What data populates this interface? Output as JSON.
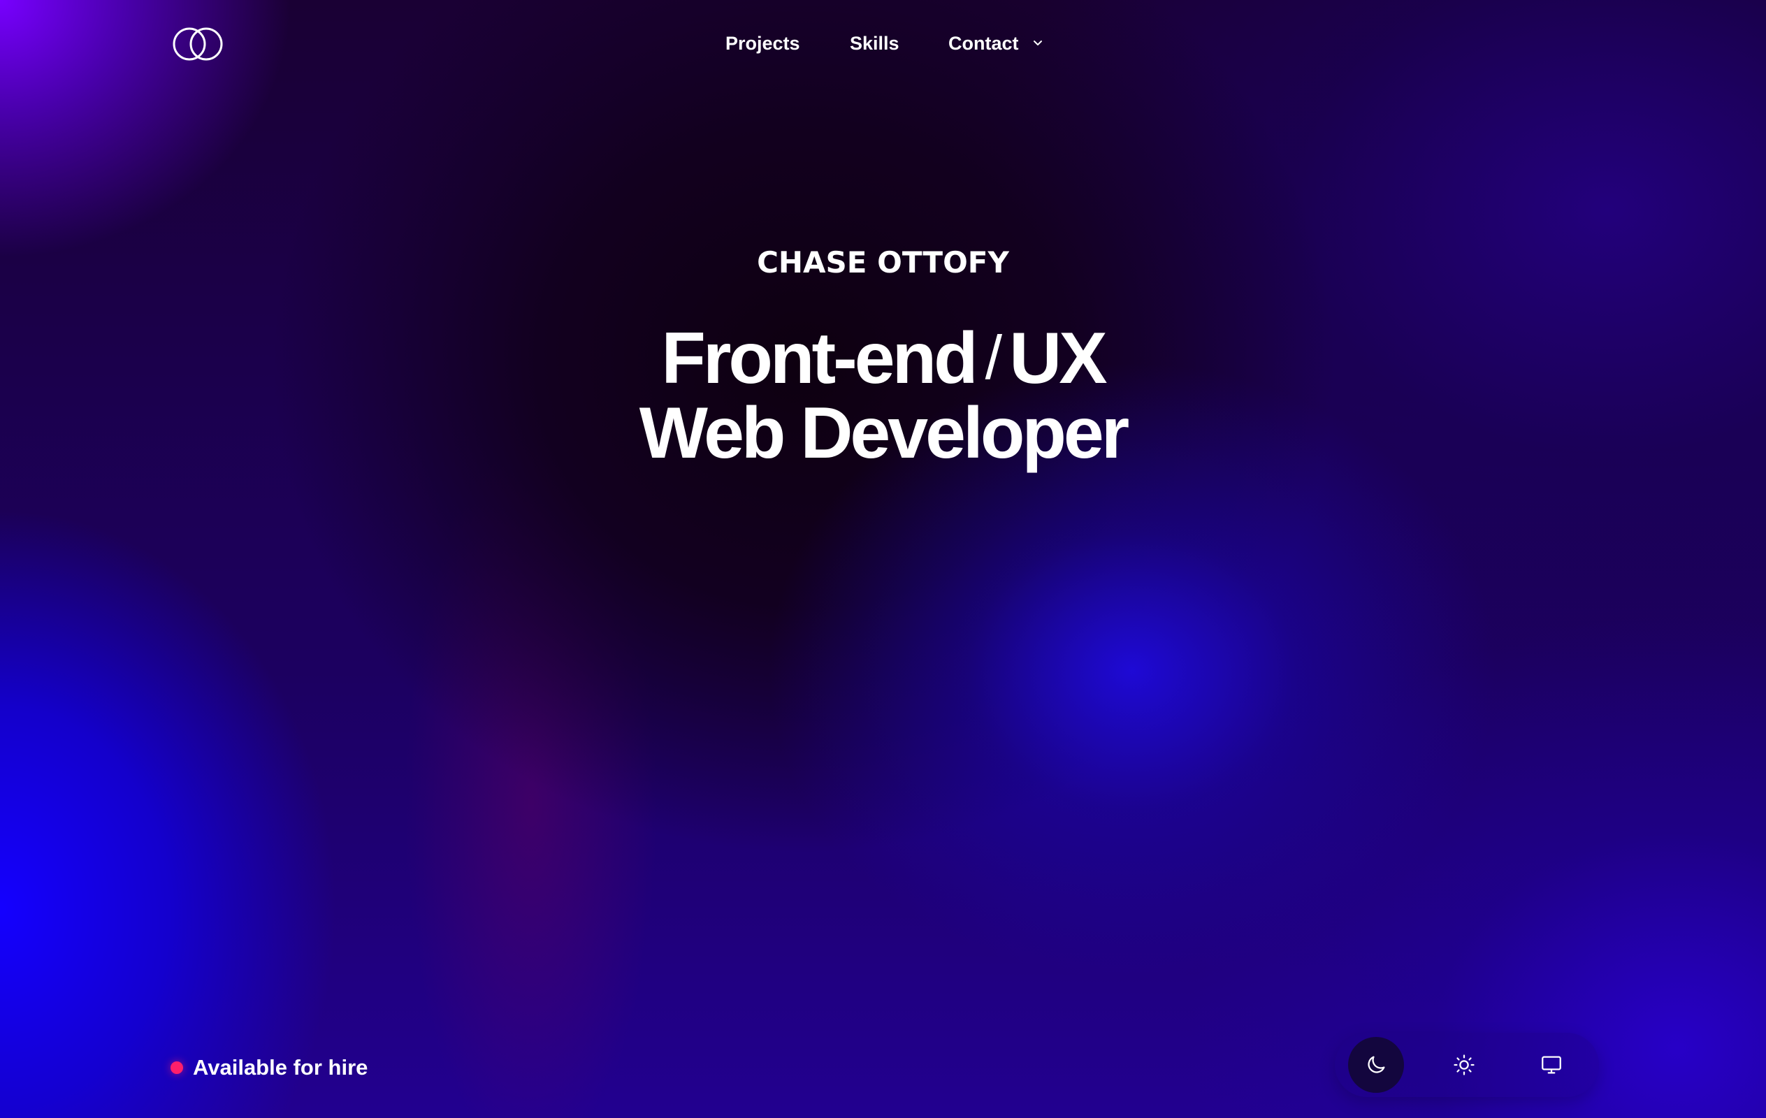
{
  "header": {
    "logo_icon": "interlocking-circles-logo",
    "nav": {
      "projects": "Projects",
      "skills": "Skills",
      "contact": "Contact"
    },
    "contact_dropdown_icon": "chevron-down-icon"
  },
  "hero": {
    "name": "CHASE OTTOFY",
    "title_line1_a": "Front-end",
    "title_separator": "/",
    "title_line1_b": "UX",
    "title_line2": "Web Developer"
  },
  "status": {
    "label": "Available for hire",
    "dot_color": "#ff1f6b"
  },
  "theme_switcher": {
    "options": [
      "moon-icon",
      "sun-icon",
      "monitor-icon"
    ],
    "selected": "dark"
  },
  "colors": {
    "background_dark": "#140022",
    "accent_blue": "#1e0adc",
    "accent_purple": "#7800ff",
    "text": "#ffffff"
  }
}
